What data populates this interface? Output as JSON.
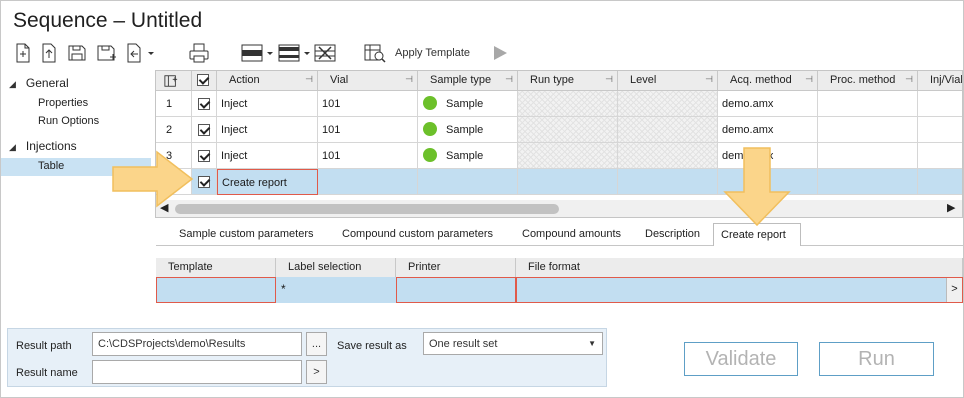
{
  "window": {
    "title": "Sequence – Untitled"
  },
  "toolbar": {
    "apply_template_label": "Apply Template",
    "icons": [
      "new-icon",
      "import-icon",
      "save-icon",
      "save-as-icon",
      "export-icon",
      "print-icon",
      "insert-row-icon",
      "insert-rows-icon",
      "delete-rows-icon",
      "template-icon",
      "run-arrow-icon"
    ]
  },
  "nav": {
    "groups": [
      {
        "label": "General",
        "items": [
          "Properties",
          "Run Options"
        ]
      },
      {
        "label": "Injections",
        "items": [
          "Table"
        ]
      }
    ]
  },
  "grid": {
    "columns": [
      "Action",
      "Vial",
      "Sample type",
      "Run type",
      "Level",
      "Acq. method",
      "Proc. method",
      "Inj/Vial"
    ],
    "rows": [
      {
        "num": "1",
        "action": "Inject",
        "vial": "101",
        "sample_type": "Sample",
        "acq_method": "demo.amx"
      },
      {
        "num": "2",
        "action": "Inject",
        "vial": "101",
        "sample_type": "Sample",
        "acq_method": "demo.amx"
      },
      {
        "num": "3",
        "action": "Inject",
        "vial": "101",
        "sample_type": "Sample",
        "acq_method": "demo.amx"
      },
      {
        "num": "",
        "action": "Create report",
        "vial": "",
        "sample_type": "",
        "acq_method": ""
      }
    ]
  },
  "tabs": [
    "Sample custom parameters",
    "Compound custom parameters",
    "Compound amounts",
    "Description",
    "Create report"
  ],
  "active_tab": "Create report",
  "report_params": {
    "columns": [
      "Template",
      "Label selection",
      "Printer",
      "File format"
    ],
    "row": {
      "template": "",
      "label_selection": "*",
      "printer": "",
      "file_format": "",
      "button": ">"
    }
  },
  "bottom": {
    "result_path_label": "Result path",
    "result_path_value": "C:\\CDSProjects\\demo\\Results",
    "browse_button": "...",
    "result_name_label": "Result name",
    "result_name_value": "",
    "result_name_button": ">",
    "save_result_label": "Save result as",
    "save_result_value": "One result set"
  },
  "actions": {
    "validate": "Validate",
    "run": "Run"
  },
  "colors": {
    "selection": "#c2def1",
    "accent_border": "#5e9fc6",
    "highlight_border": "#e05a4a",
    "sample_dot": "#6cc02a",
    "callout_arrow": "#fbd58a"
  }
}
